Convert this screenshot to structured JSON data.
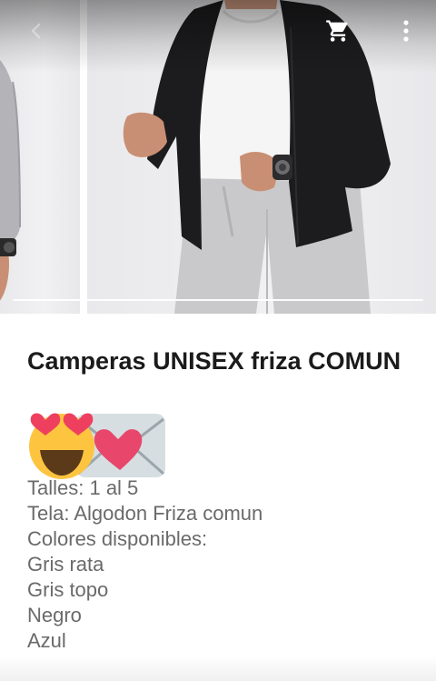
{
  "toolbar": {
    "back_icon": "chevron-left-icon",
    "cart_icon": "shopping-cart-icon",
    "more_icon": "more-vertical-icon"
  },
  "gallery": {
    "images": [
      "previous-product-photo",
      "current-product-photo"
    ],
    "scrim_color": "#000000",
    "indicator_color": "#ffffff"
  },
  "product": {
    "title": "Camperas UNISEX friza COMUN",
    "emojis": [
      "heart-eyes-emoji",
      "love-letter-emoji"
    ],
    "details": [
      "Talles: 1 al 5",
      "Tela: Algodon Friza comun",
      "Colores disponibles:",
      "Gris rata",
      "Gris topo",
      "Negro",
      "Azul"
    ]
  },
  "colors": {
    "title_text": "#1b1b1b",
    "body_text": "#6a6a6a",
    "jacket": "#1c1c1e",
    "sweatpants": "#c9c9cb"
  }
}
